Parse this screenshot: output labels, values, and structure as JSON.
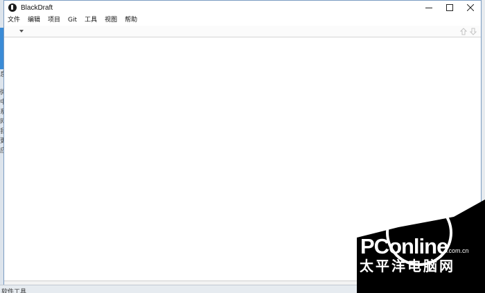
{
  "window": {
    "title": "BlackDraft",
    "minimize_icon": "minimize-icon",
    "maximize_icon": "maximize-icon",
    "close_icon": "close-icon"
  },
  "menu": {
    "items": [
      "文件",
      "编辑",
      "项目",
      "Git",
      "工具",
      "视图",
      "帮助"
    ]
  },
  "toolbar": {
    "dropdown_icon": "dropdown-arrow-icon",
    "up_icon": "arrow-up-icon",
    "down_icon": "arrow-down-icon"
  },
  "left_strip": {
    "glyphs": [
      "息",
      "微",
      "中",
      "系",
      "网",
      "我",
      "更",
      "应"
    ]
  },
  "bottom_strip": {
    "text": "软件工具"
  },
  "watermark": {
    "brand": "PConline",
    "domain": ".com.cn",
    "chinese": "太平洋电脑网"
  },
  "colors": {
    "window_border": "#7a9bc2",
    "watermark_bg": "#000000"
  }
}
